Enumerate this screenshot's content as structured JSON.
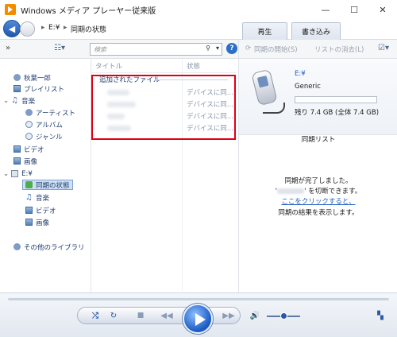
{
  "window": {
    "title": "Windows メディア プレーヤー従来版"
  },
  "nav": {
    "breadcrumb": [
      "E:¥",
      "同期の状態"
    ],
    "tabs": [
      "再生",
      "書き込み"
    ]
  },
  "toolbar": {
    "search_placeholder": "検索"
  },
  "sidebar": {
    "user": "秋葉一郎",
    "library_items": [
      "プレイリスト",
      "音楽",
      "アーティスト",
      "アルバム",
      "ジャンル",
      "ビデオ",
      "画像"
    ],
    "device": "E:¥",
    "device_items": [
      "同期の状態",
      "音楽",
      "ビデオ",
      "画像"
    ],
    "other": "その他のライブラリ"
  },
  "list": {
    "col_title": "タイトル",
    "col_status": "状態",
    "group": "追加されたファイル",
    "rows": [
      {
        "status": "デバイスに同..."
      },
      {
        "status": "デバイスに同..."
      },
      {
        "status": "デバイスに同..."
      },
      {
        "status": "デバイスに同..."
      }
    ]
  },
  "sync_panel": {
    "start_sync": "同期の開始(S)",
    "clear_list": "リストの消去(L)",
    "device_name": "E:¥",
    "device_model": "Generic",
    "capacity": "残り 7.4 GB (全体 7.4 GB)",
    "used_fraction": 0.0,
    "list_title": "同期リスト",
    "msg1": "同期が完了しました。",
    "msg2_prefix": "'",
    "msg2_suffix": "' を切断できます。",
    "link": "ここをクリックすると、",
    "msg3": "同期の結果を表示します。"
  },
  "player": {
    "volume": 0.5
  },
  "icons": [
    "back-arrow-icon",
    "forward-arrow-icon",
    "search-icon",
    "help-icon",
    "shuffle-icon",
    "repeat-icon",
    "stop-icon",
    "previous-icon",
    "play-icon",
    "next-icon",
    "volume-icon",
    "switch-view-icon"
  ]
}
